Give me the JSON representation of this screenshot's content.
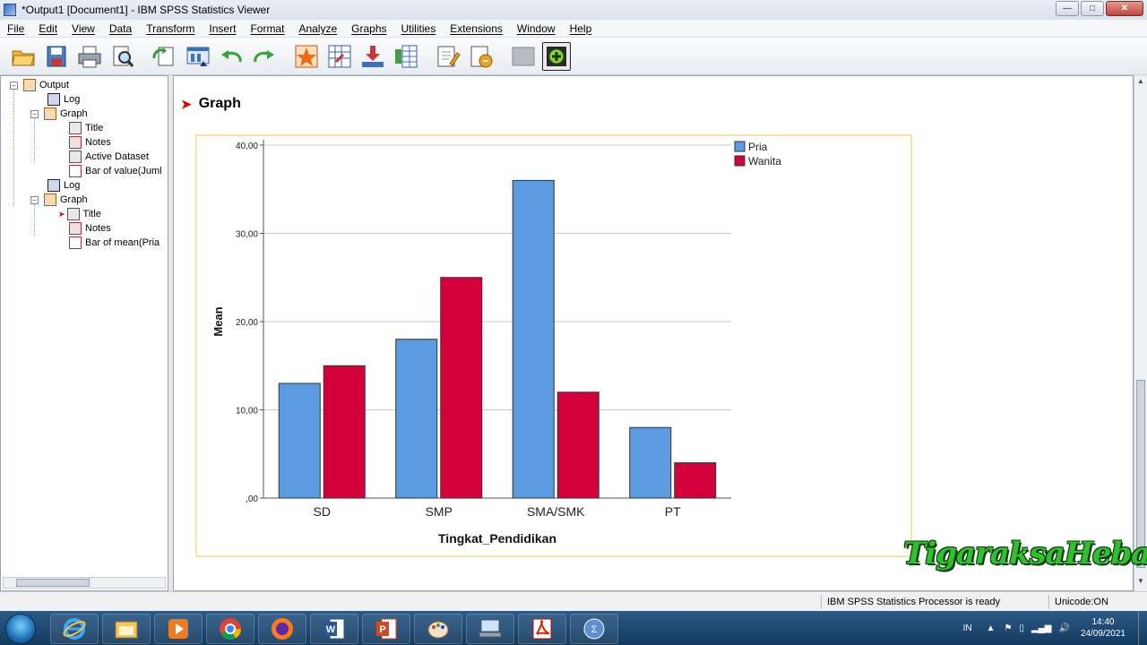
{
  "window": {
    "title": "*Output1 [Document1] - IBM SPSS Statistics Viewer",
    "controls": [
      "minimize",
      "maximize",
      "close"
    ]
  },
  "menu": [
    "File",
    "Edit",
    "View",
    "Data",
    "Transform",
    "Insert",
    "Format",
    "Analyze",
    "Graphs",
    "Utilities",
    "Extensions",
    "Window",
    "Help"
  ],
  "toolbar": {
    "icons": [
      "open-icon",
      "save-icon",
      "print-icon",
      "print-preview-icon",
      "export-icon",
      "recall-dialog-icon",
      "undo-icon",
      "redo-icon",
      "goto-data-icon",
      "goto-case-icon",
      "insert-output-icon",
      "designate-window-icon",
      "new-title-icon",
      "insert-text-icon",
      "hidden-item-icon",
      "promote-icon"
    ]
  },
  "tree": {
    "items": [
      {
        "label": "Output",
        "icon": "output-icon",
        "level": 0
      },
      {
        "label": "Log",
        "icon": "log-icon",
        "level": 1
      },
      {
        "label": "Graph",
        "icon": "graph-icon",
        "level": 1
      },
      {
        "label": "Title",
        "icon": "title-icon",
        "level": 2
      },
      {
        "label": "Notes",
        "icon": "notes-icon",
        "level": 2
      },
      {
        "label": "Active Dataset",
        "icon": "dataset-icon",
        "level": 2
      },
      {
        "label": "Bar of value(Juml",
        "icon": "bar-chart-icon",
        "level": 2
      },
      {
        "label": "Log",
        "icon": "log-icon",
        "level": 1
      },
      {
        "label": "Graph",
        "icon": "graph-icon",
        "level": 1
      },
      {
        "label": "Title",
        "icon": "title-icon",
        "level": 2,
        "current": true
      },
      {
        "label": "Notes",
        "icon": "notes-icon",
        "level": 2
      },
      {
        "label": "Bar of mean(Pria",
        "icon": "bar-chart-icon",
        "level": 2
      }
    ]
  },
  "content": {
    "heading": "Graph"
  },
  "chart_data": {
    "type": "bar",
    "categories": [
      "SD",
      "SMP",
      "SMA/SMK",
      "PT"
    ],
    "series": [
      {
        "name": "Pria",
        "values": [
          13,
          18,
          36,
          8
        ],
        "color": "#5b9be0"
      },
      {
        "name": "Wanita",
        "values": [
          15,
          25,
          12,
          4
        ],
        "color": "#d3003b"
      }
    ],
    "title": "",
    "xlabel": "Tingkat_Pendidikan",
    "ylabel": "Mean",
    "ylim": [
      0,
      40
    ],
    "yticks": [
      0,
      10,
      20,
      30,
      40
    ],
    "ytick_labels": [
      ",00",
      "10,00",
      "20,00",
      "30,00",
      "40,00"
    ],
    "grid": true,
    "legend": "top-right"
  },
  "status": {
    "processor": "IBM SPSS Statistics Processor is ready",
    "encoding": "Unicode:ON"
  },
  "taskbar": {
    "apps": [
      "internet-explorer-icon",
      "file-explorer-icon",
      "media-player-icon",
      "chrome-icon",
      "firefox-icon",
      "word-icon",
      "powerpoint-icon",
      "paint-icon",
      "network-icon",
      "acrobat-icon",
      "spss-icon"
    ],
    "language": "IN",
    "time": "14:40",
    "date": "24/09/2021"
  },
  "watermark": "TigaraksaHebat"
}
